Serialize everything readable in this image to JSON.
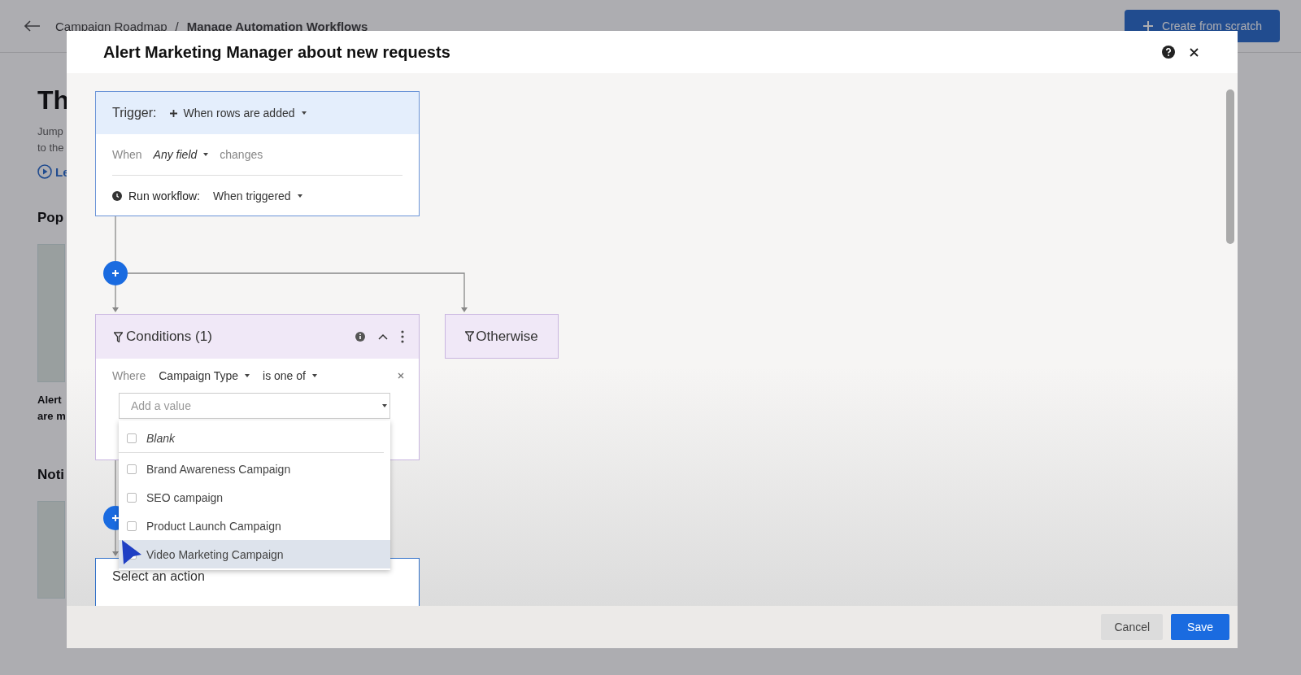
{
  "page": {
    "breadcrumb": [
      "Campaign Roadmap",
      "Manage Automation Workflows"
    ],
    "breadcrumb_separator": "/",
    "create_button": "Create from scratch",
    "heading": "Th",
    "intro": [
      "Jump",
      "to the"
    ],
    "link": "Le",
    "section_1": "Pop",
    "card_text": [
      "Alert",
      "are m"
    ],
    "section_2": "Noti"
  },
  "modal": {
    "title": "Alert Marketing Manager about new requests",
    "trigger": {
      "label": "Trigger:",
      "event": "When rows are added",
      "when": "When",
      "field": "Any field",
      "changes": "changes",
      "run_label": "Run workflow:",
      "run_value": "When triggered"
    },
    "conditions": {
      "title": "Conditions (1)",
      "expanded": true,
      "where": "Where",
      "field": "Campaign Type",
      "operator": "is one of",
      "value_placeholder": "Add a value"
    },
    "otherwise": {
      "title": "Otherwise"
    },
    "options": [
      {
        "label": "Blank",
        "italic": true,
        "checked": false,
        "selected": false
      },
      {
        "label": "Brand Awareness Campaign",
        "italic": false,
        "checked": false,
        "selected": false
      },
      {
        "label": "SEO campaign",
        "italic": false,
        "checked": false,
        "selected": false
      },
      {
        "label": "Product Launch Campaign",
        "italic": false,
        "checked": false,
        "selected": false
      },
      {
        "label": "Video Marketing Campaign",
        "italic": false,
        "checked": false,
        "selected": true
      }
    ],
    "action": {
      "title": "Select an action"
    },
    "buttons": [
      {
        "label": "Cancel",
        "kind": "secondary"
      },
      {
        "label": "Save",
        "kind": "primary"
      }
    ]
  }
}
